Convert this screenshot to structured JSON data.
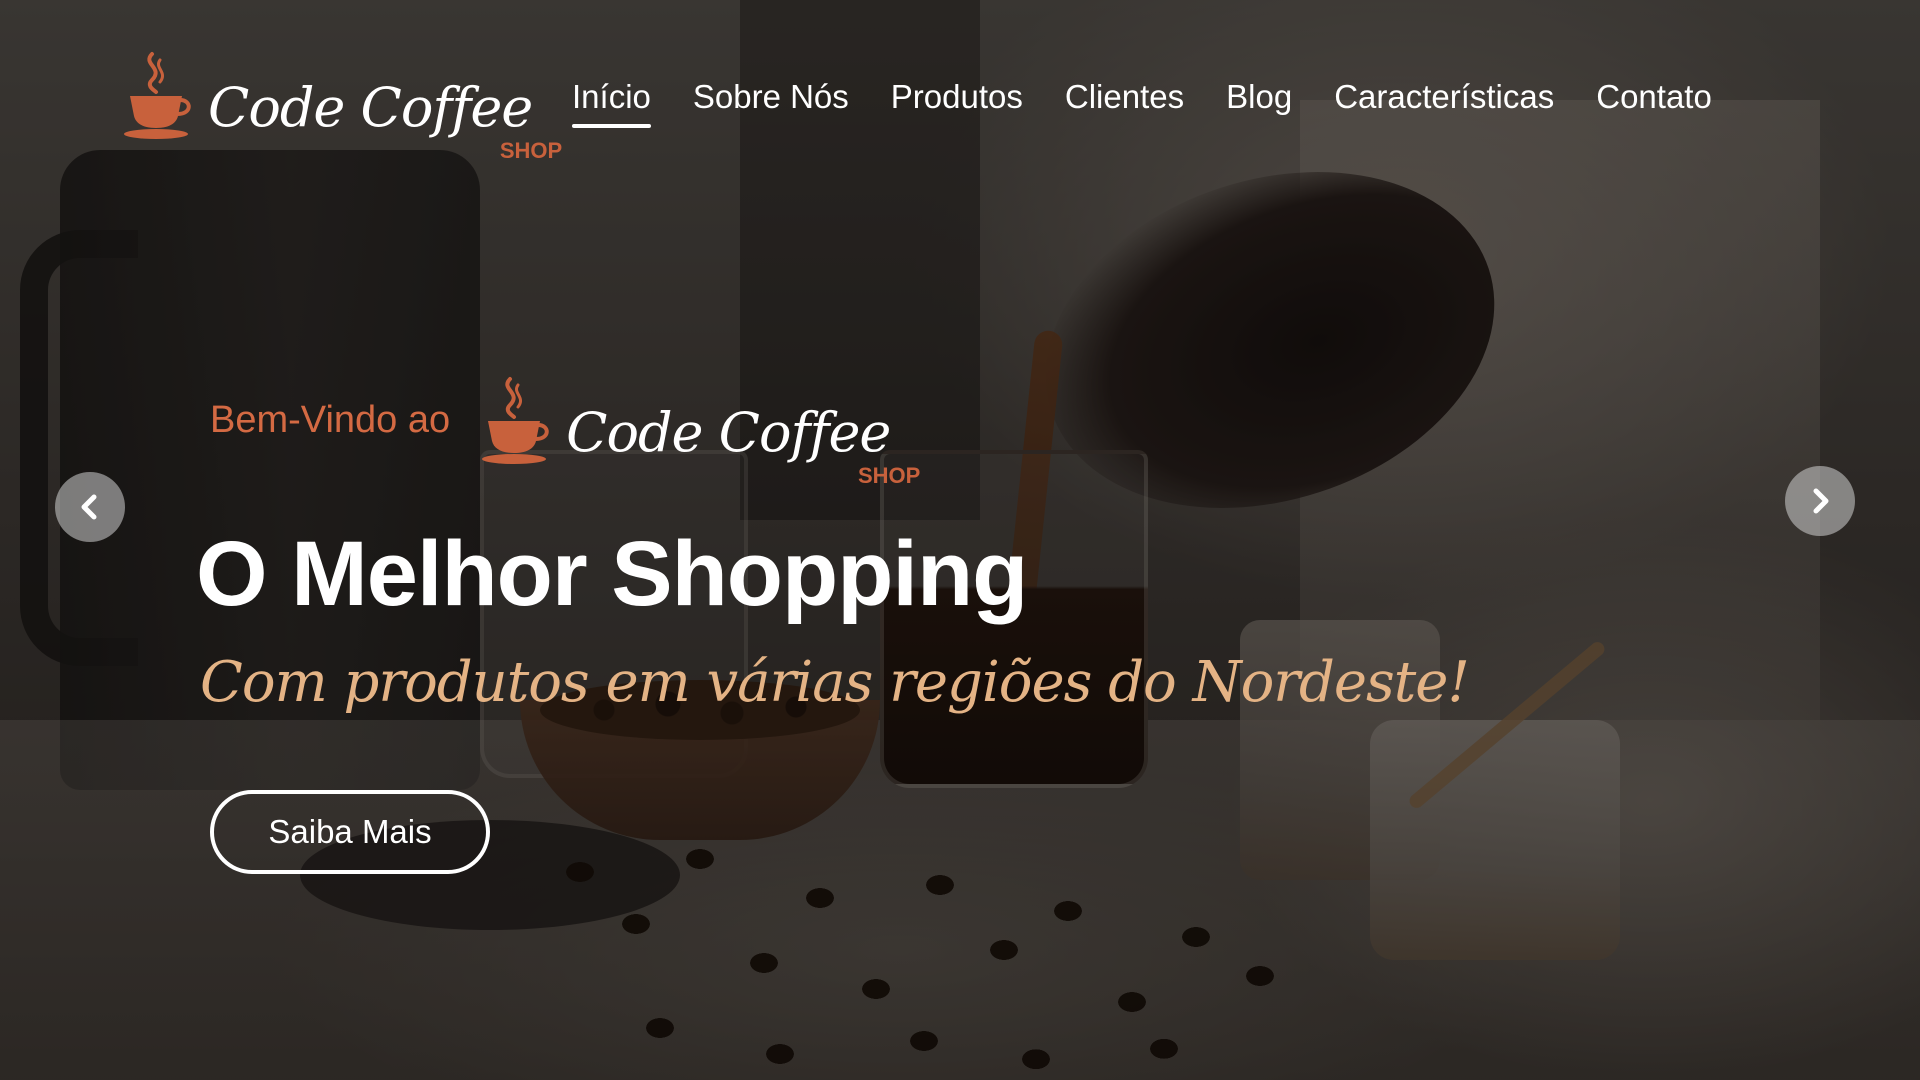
{
  "brand": {
    "script": "Code Coffee",
    "shop": "SHOP",
    "accent_color": "#c8613c",
    "icon": "coffee-cup-icon"
  },
  "nav": {
    "items": [
      {
        "label": "Início",
        "active": true
      },
      {
        "label": "Sobre Nós",
        "active": false
      },
      {
        "label": "Produtos",
        "active": false
      },
      {
        "label": "Clientes",
        "active": false
      },
      {
        "label": "Blog",
        "active": false
      },
      {
        "label": "Características",
        "active": false
      },
      {
        "label": "Contato",
        "active": false
      }
    ]
  },
  "hero": {
    "welcome": "Bem-Vindo ao",
    "headline": "O Melhor Shopping",
    "subline": "Com produtos em várias regiões do Nordeste!",
    "cta_label": "Saiba Mais",
    "welcome_color": "#d46a43",
    "subline_color": "#e4b385"
  },
  "carousel": {
    "prev_icon": "chevron-left-icon",
    "next_icon": "chevron-right-icon"
  }
}
